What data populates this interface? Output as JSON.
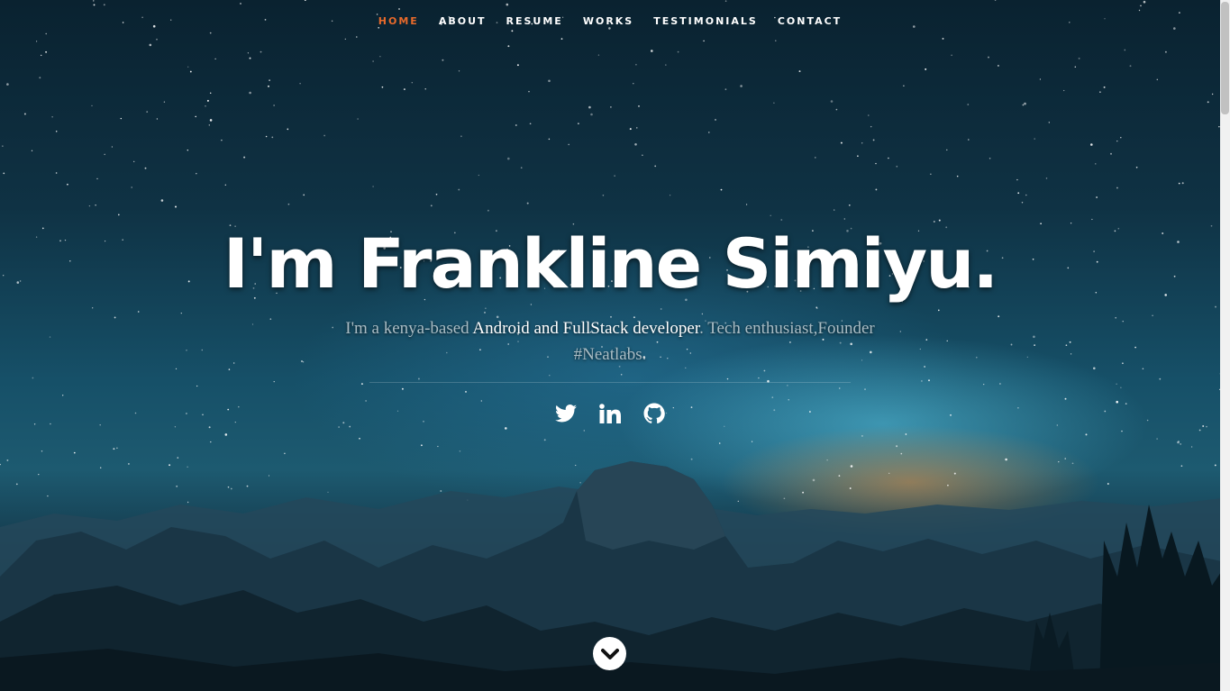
{
  "nav": {
    "items": [
      {
        "label": "HOME",
        "active": true
      },
      {
        "label": "ABOUT",
        "active": false
      },
      {
        "label": "RESUME",
        "active": false
      },
      {
        "label": "WORKS",
        "active": false
      },
      {
        "label": "TESTIMONIALS",
        "active": false
      },
      {
        "label": "CONTACT",
        "active": false
      }
    ],
    "active_color": "#e86a2b"
  },
  "hero": {
    "headline": "I'm Frankline Simiyu.",
    "subtitle_prefix": "I'm a kenya-based ",
    "subtitle_emphasis": "Android and FullStack developer",
    "subtitle_suffix": ". Tech enthusiast,Founder #Neatlabs."
  },
  "social": [
    {
      "name": "twitter-icon"
    },
    {
      "name": "linkedin-icon"
    },
    {
      "name": "github-icon"
    }
  ],
  "scroll_down": {
    "icon": "chevron-down-icon"
  }
}
